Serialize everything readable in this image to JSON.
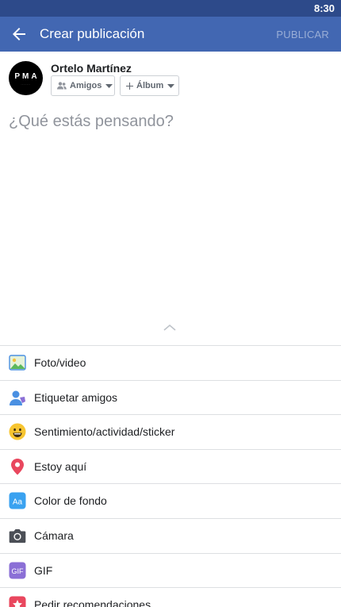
{
  "status_bar": {
    "time": "8:30"
  },
  "header": {
    "back_icon": "arrow-left-icon",
    "title": "Crear publicación",
    "publish_label": "PUBLICAR"
  },
  "user": {
    "name": "Ortelo Martínez",
    "avatar_text": "PMA",
    "privacy_label": "Amigos",
    "privacy_icon": "friends-icon",
    "album_label": "Álbum",
    "album_icon": "plus-icon"
  },
  "composer": {
    "placeholder": "¿Qué estás pensando?"
  },
  "options": [
    {
      "label": "Foto/video",
      "icon": "photo-icon"
    },
    {
      "label": "Etiquetar amigos",
      "icon": "tag-friends-icon"
    },
    {
      "label": "Sentimiento/actividad/sticker",
      "icon": "smiley-icon"
    },
    {
      "label": "Estoy aquí",
      "icon": "location-pin-icon"
    },
    {
      "label": "Color de fondo",
      "icon": "background-color-icon"
    },
    {
      "label": "Cámara",
      "icon": "camera-icon"
    },
    {
      "label": "GIF",
      "icon": "gif-icon"
    },
    {
      "label": "Pedir recomendaciones",
      "icon": "recommendations-icon"
    }
  ],
  "colors": {
    "brand_blue": "#4267b2",
    "status_bar": "#2d4a8a",
    "publish_disabled": "#9aaed6",
    "placeholder": "#90949c",
    "divider": "#dddfe2"
  }
}
